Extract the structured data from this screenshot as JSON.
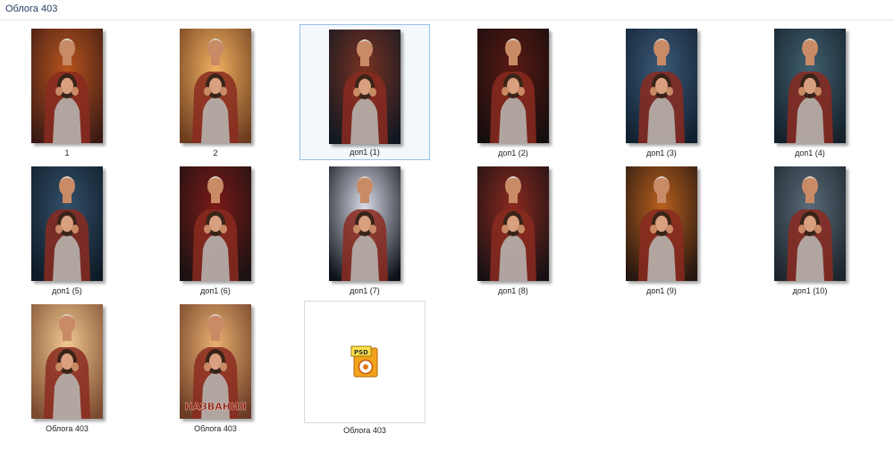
{
  "window": {
    "title": "Облога 403"
  },
  "files": [
    {
      "name": "1",
      "bg": "#3a1a14",
      "glow": "#b8541e",
      "selected": false
    },
    {
      "name": "2",
      "bg": "#6b3c1e",
      "glow": "#f0b060",
      "selected": false
    },
    {
      "name": "доп1 (1)",
      "bg": "#101822",
      "glow": "#7a3222",
      "selected": true
    },
    {
      "name": "доп1 (2)",
      "bg": "#140d0d",
      "glow": "#5a1a14",
      "selected": false
    },
    {
      "name": "доп1 (3)",
      "bg": "#112030",
      "glow": "#3b5a78",
      "selected": false
    },
    {
      "name": "доп1 (4)",
      "bg": "#14202a",
      "glow": "#406070",
      "selected": false
    },
    {
      "name": "доп1 (5)",
      "bg": "#0e1a26",
      "glow": "#33506a",
      "selected": false
    },
    {
      "name": "доп1 (6)",
      "bg": "#1a1212",
      "glow": "#7a1a18",
      "selected": false
    },
    {
      "name": "доп1 (7)",
      "bg": "#0c1018",
      "glow": "#d8dbe6",
      "selected": false
    },
    {
      "name": "доп1 (8)",
      "bg": "#161014",
      "glow": "#8a2a1e",
      "selected": false
    },
    {
      "name": "доп1 (9)",
      "bg": "#241610",
      "glow": "#b8601e",
      "selected": false
    },
    {
      "name": "доп1 (10)",
      "bg": "#1c242c",
      "glow": "#5a6a78",
      "selected": false
    },
    {
      "name": "Облога  403",
      "bg": "#7a4a2e",
      "glow": "#f0c890",
      "selected": false
    },
    {
      "name": "Облога 403",
      "bg": "#6a3a24",
      "glow": "#e8b070",
      "selected": false,
      "cover_text": "НАЗВАНИЯ"
    }
  ],
  "psd_file": {
    "name": "Облога 403",
    "icon": "psd-file-icon",
    "icon_label": "PSD"
  }
}
